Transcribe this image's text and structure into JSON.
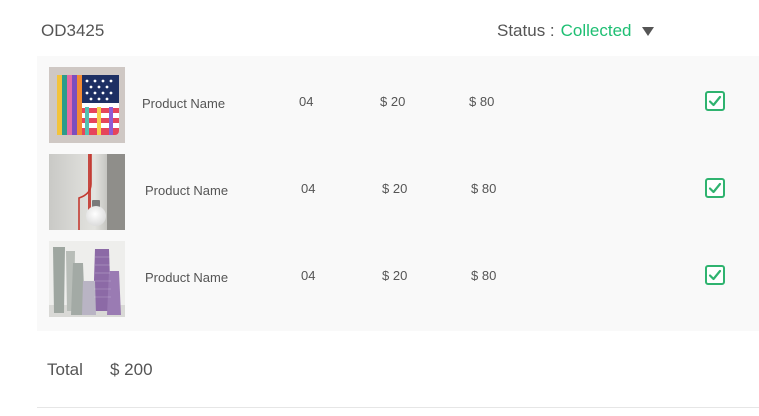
{
  "order": {
    "id": "OD3425",
    "status_label": "Status :",
    "status_value": "Collected",
    "status_color": "#1ebf73"
  },
  "items": [
    {
      "name": "Product Name",
      "quantity": "04",
      "unit_price": "$ 20",
      "line_total": "$ 80",
      "checked": true,
      "image": "patterned-cushion"
    },
    {
      "name": "Product Name",
      "quantity": "04",
      "unit_price": "$ 20",
      "line_total": "$ 80",
      "checked": true,
      "image": "pendant-bulb-lamp"
    },
    {
      "name": "Product Name",
      "quantity": "04",
      "unit_price": "$ 20",
      "line_total": "$ 80",
      "checked": true,
      "image": "ceramic-vases"
    }
  ],
  "summary": {
    "total_label": "Total",
    "total_value": "$ 200"
  }
}
